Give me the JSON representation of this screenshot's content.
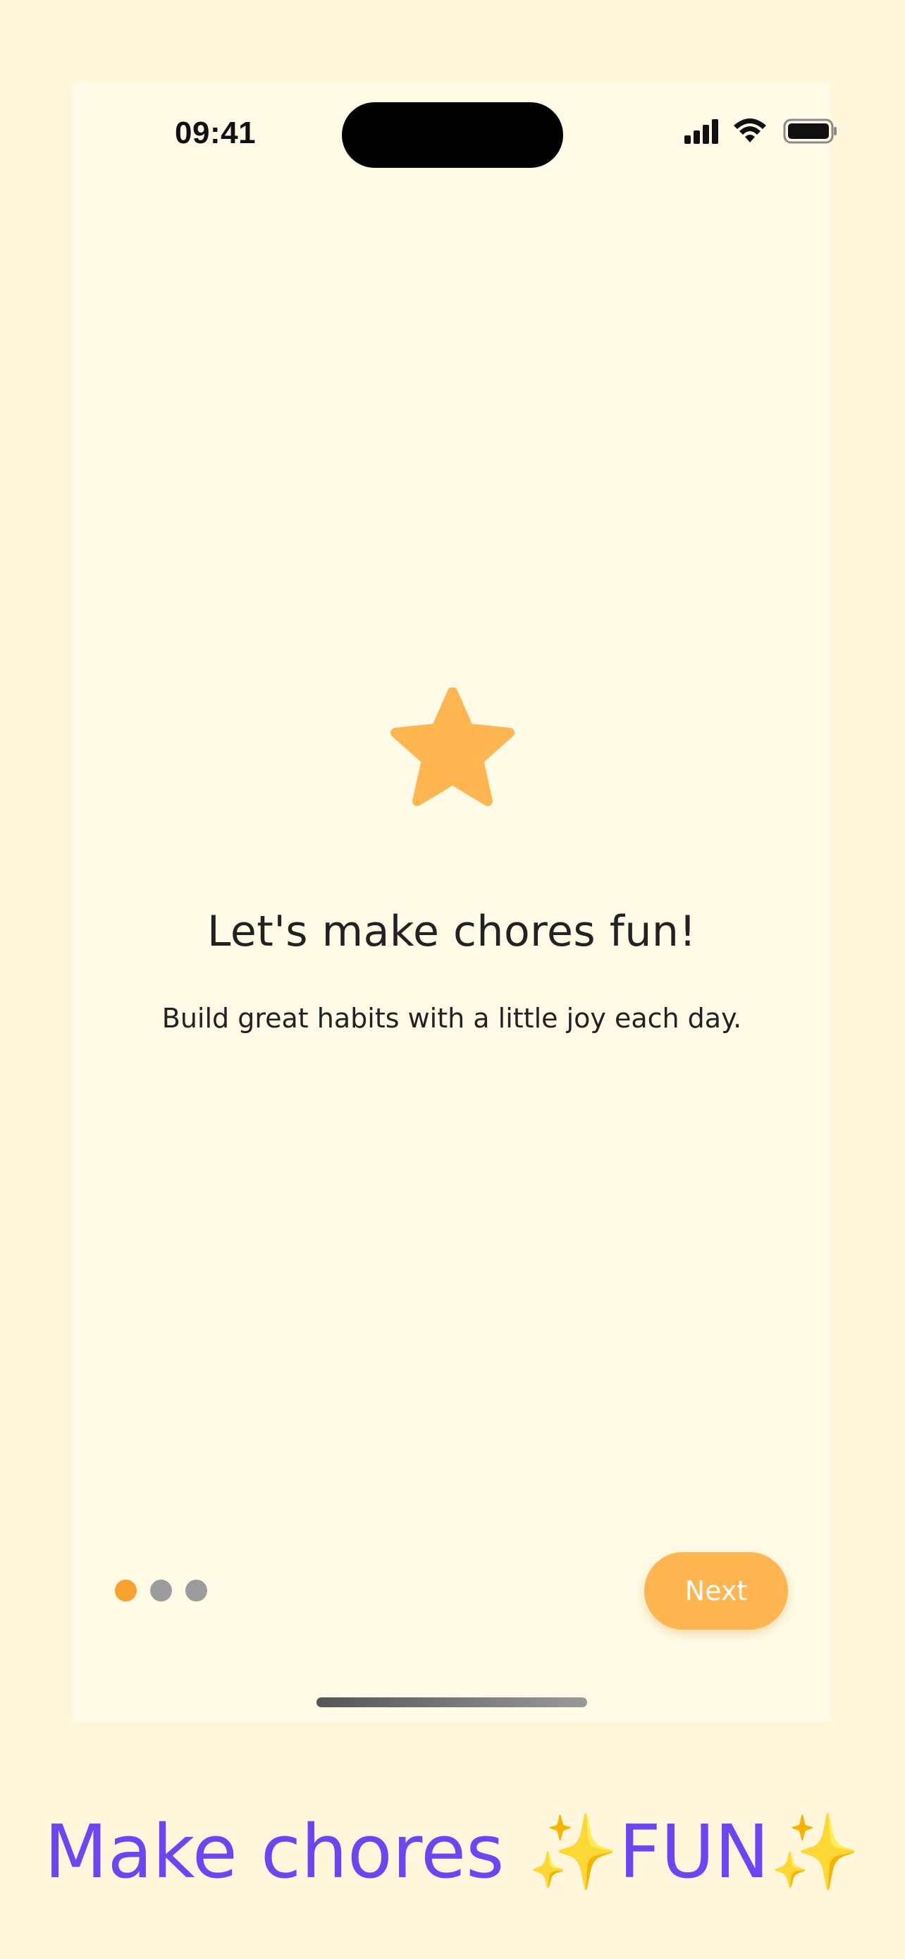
{
  "status_bar": {
    "time": "09:41",
    "icons": [
      "cellular-signal-icon",
      "wifi-icon",
      "battery-icon"
    ]
  },
  "onboarding": {
    "icon": "star-icon",
    "title": "Let's make chores fun!",
    "subtitle": "Build great habits with a little joy each day.",
    "pager": {
      "total_pages": 3,
      "current_page": 1
    },
    "next_label": "Next"
  },
  "caption": {
    "text": "Make chores ",
    "sparkle_left": "✨",
    "emphasis": "FUN",
    "sparkle_right": "✨"
  },
  "colors": {
    "page_background": "#fff6dc",
    "screen_background": "#fffbe6",
    "accent": "#ffb550",
    "active_dot": "#f7a22e",
    "inactive_dot": "#9c9c9c",
    "caption": "#6b46f2"
  }
}
